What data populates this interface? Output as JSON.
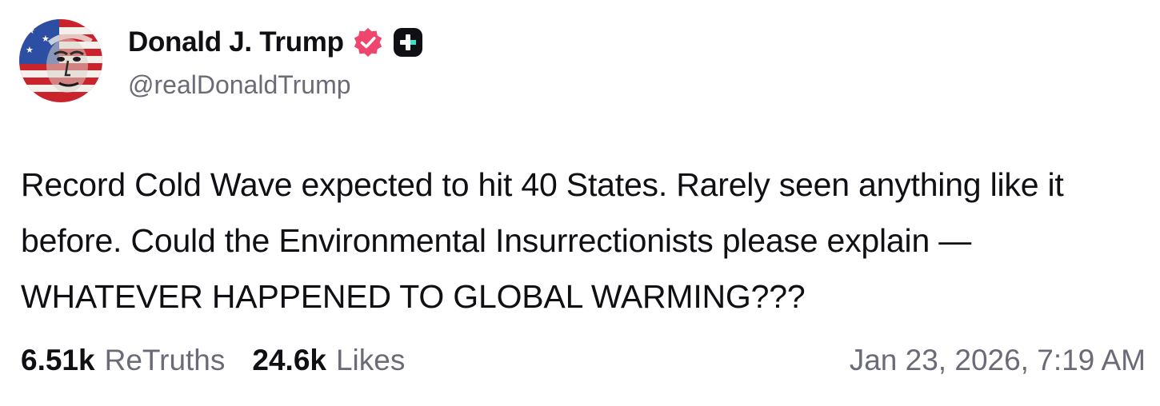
{
  "author": {
    "display_name": "Donald J. Trump",
    "handle": "@realDonaldTrump",
    "verified_icon": "verified-badge-icon",
    "badge_icon": "plus-badge-icon"
  },
  "post": {
    "text": "Record Cold Wave expected to hit 40 States. Rarely seen anything like it before. Could the Environmental Insurrectionists please explain — WHATEVER HAPPENED TO GLOBAL WARMING???"
  },
  "stats": {
    "retruths_count": "6.51k",
    "retruths_label": "ReTruths",
    "likes_count": "24.6k",
    "likes_label": "Likes"
  },
  "timestamp": "Jan 23, 2026, 7:19 AM",
  "colors": {
    "text_primary": "#0f0f14",
    "text_secondary": "#6b6b78",
    "verified_badge": "#f0466e",
    "plus_badge": "#0f0f14",
    "plus_badge_accent": "#3fe0c8"
  }
}
